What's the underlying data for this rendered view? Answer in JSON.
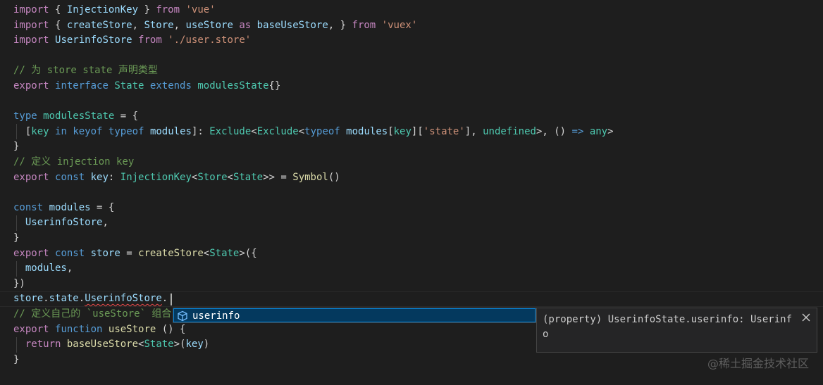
{
  "editor": {
    "tokens": {
      "import": "import",
      "from": "from",
      "export": "export",
      "interface": "interface",
      "extends": "extends",
      "type": "type",
      "in": "in",
      "keyof": "keyof",
      "typeof": "typeof",
      "const": "const",
      "function": "function",
      "return": "return",
      "as": "as",
      "undefined": "undefined",
      "any": "any",
      "InjectionKey": "InjectionKey",
      "createStore": "createStore",
      "Store": "Store",
      "useStore": "useStore",
      "baseUseStore": "baseUseStore",
      "UserinfoStore": "UserinfoStore",
      "State": "State",
      "modulesState": "modulesState",
      "key": "key",
      "modules": "modules",
      "Exclude": "Exclude",
      "Symbol": "Symbol",
      "store": "store",
      "state": "state",
      "vue_str": "'vue'",
      "vuex_str": "'vuex'",
      "userstore_str": "'./user.store'",
      "state_str": "'state'",
      "comment_state_type": "// 为 store state 声明类型",
      "comment_define_key": "// 定义 injection key",
      "comment_define_usestore": "// 定义自己的 `useStore` 组合"
    }
  },
  "suggest": {
    "icon": "cube-property-icon",
    "label": "userinfo"
  },
  "details": {
    "text": "(property) UserinfoState.userinfo: Userinfo",
    "close_icon": "close-icon"
  },
  "watermark": "@稀土掘金技术社区",
  "colors": {
    "background": "#1e1e1e",
    "keyword_control": "#c586c0",
    "keyword": "#569cd6",
    "variable": "#9cdcfe",
    "type": "#4ec9b0",
    "string": "#ce9178",
    "function": "#dcdcaa",
    "comment": "#6a9955",
    "selection": "#04395e",
    "focus_border": "#007fd4"
  }
}
